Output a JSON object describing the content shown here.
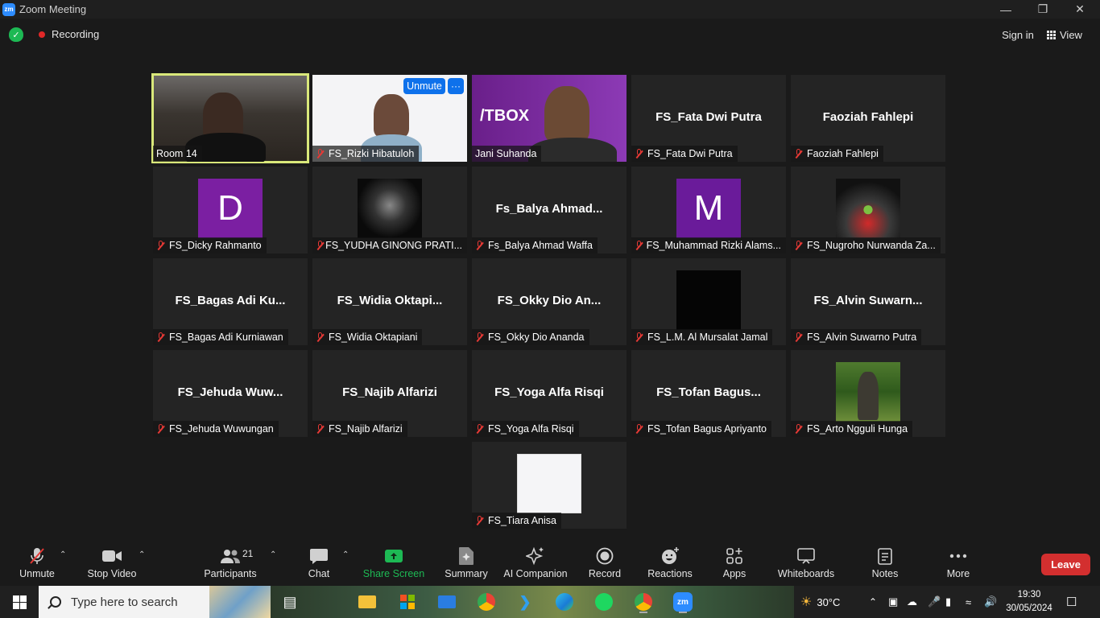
{
  "window": {
    "app_logo": "zm",
    "title": "Zoom Meeting",
    "controls": [
      "minimize-icon",
      "restore-icon",
      "close-icon"
    ]
  },
  "topbar": {
    "security_icon": "shield-check-icon",
    "recording_label": "Recording",
    "signin_label": "Sign in",
    "view_label": "View"
  },
  "tiles": [
    {
      "name": "Room 14",
      "muted": false,
      "type": "video"
    },
    {
      "name": "FS_Rizki Hibatuloh",
      "muted": true,
      "type": "video",
      "unmute_label": "Unmute",
      "more_label": "···"
    },
    {
      "name": "Jani Suhanda",
      "muted": false,
      "type": "video",
      "brand_text": "/TBOX"
    },
    {
      "name": "FS_Fata Dwi Putra",
      "muted": true,
      "display": "FS_Fata Dwi Putra"
    },
    {
      "name": "Faoziah Fahlepi",
      "muted": true,
      "display": "Faoziah Fahlepi"
    },
    {
      "name": "FS_Dicky Rahmanto",
      "muted": true,
      "avatar_letter": "D",
      "avatar_color": "#7b1fa2"
    },
    {
      "name": "FS_YUDHA GINONG PRATI...",
      "muted": true,
      "avatar_image": "black-rose"
    },
    {
      "name": "Fs_Balya Ahmad Waffa",
      "muted": true,
      "display": "Fs_Balya  Ahmad..."
    },
    {
      "name": "FS_Muhammad Rizki Alams...",
      "muted": true,
      "avatar_letter": "M",
      "avatar_color": "#6a1b9a"
    },
    {
      "name": "FS_Nugroho Nurwanda Za...",
      "muted": true,
      "avatar_image": "speedometer-android"
    },
    {
      "name": "FS_Bagas Adi Kurniawan",
      "muted": true,
      "display": "FS_Bagas  Adi  Ku..."
    },
    {
      "name": "FS_Widia Oktapiani",
      "muted": true,
      "display": "FS_Widia  Oktapi..."
    },
    {
      "name": "FS_Okky Dio Ananda",
      "muted": true,
      "display": "FS_Okky  Dio  An..."
    },
    {
      "name": "FS_L.M. Al Mursalat Jamal",
      "muted": true,
      "avatar_image": "black-square"
    },
    {
      "name": "FS_Alvin Suwarno Putra",
      "muted": true,
      "display": "FS_Alvin  Suwarn..."
    },
    {
      "name": "FS_Jehuda Wuwungan",
      "muted": true,
      "display": "FS_Jehuda  Wuw..."
    },
    {
      "name": "FS_Najib Alfarizi",
      "muted": true,
      "display": "FS_Najib Alfarizi"
    },
    {
      "name": "FS_Yoga Alfa Risqi",
      "muted": true,
      "display": "FS_Yoga Alfa Risqi"
    },
    {
      "name": "FS_Tofan Bagus Apriyanto",
      "muted": true,
      "display": "FS_Tofan  Bagus..."
    },
    {
      "name": "FS_Arto Ngguli Hunga",
      "muted": true,
      "avatar_image": "man-in-forest"
    },
    {
      "name": "FS_Tiara Anisa",
      "muted": true,
      "avatar_image": "white-pattern"
    }
  ],
  "toolbar": {
    "unmute": "Unmute",
    "stop_video": "Stop Video",
    "participants": "Participants",
    "participants_count": "21",
    "chat": "Chat",
    "share_screen": "Share Screen",
    "summary": "Summary",
    "ai_companion": "AI Companion",
    "record": "Record",
    "reactions": "Reactions",
    "apps": "Apps",
    "whiteboards": "Whiteboards",
    "notes": "Notes",
    "more": "More",
    "leave": "Leave",
    "share_color": "#1db954",
    "leave_color": "#d32f2f"
  },
  "taskbar": {
    "search_placeholder": "Type here to search",
    "apps": [
      "task-view-icon",
      "file-explorer-icon",
      "microsoft-store-icon",
      "mail-icon",
      "chrome-icon",
      "vscode-icon",
      "edge-icon",
      "spotify-icon",
      "chrome-profile-icon",
      "zoom-icon"
    ],
    "weather": "30°C",
    "time": "19:30",
    "date": "30/05/2024"
  }
}
